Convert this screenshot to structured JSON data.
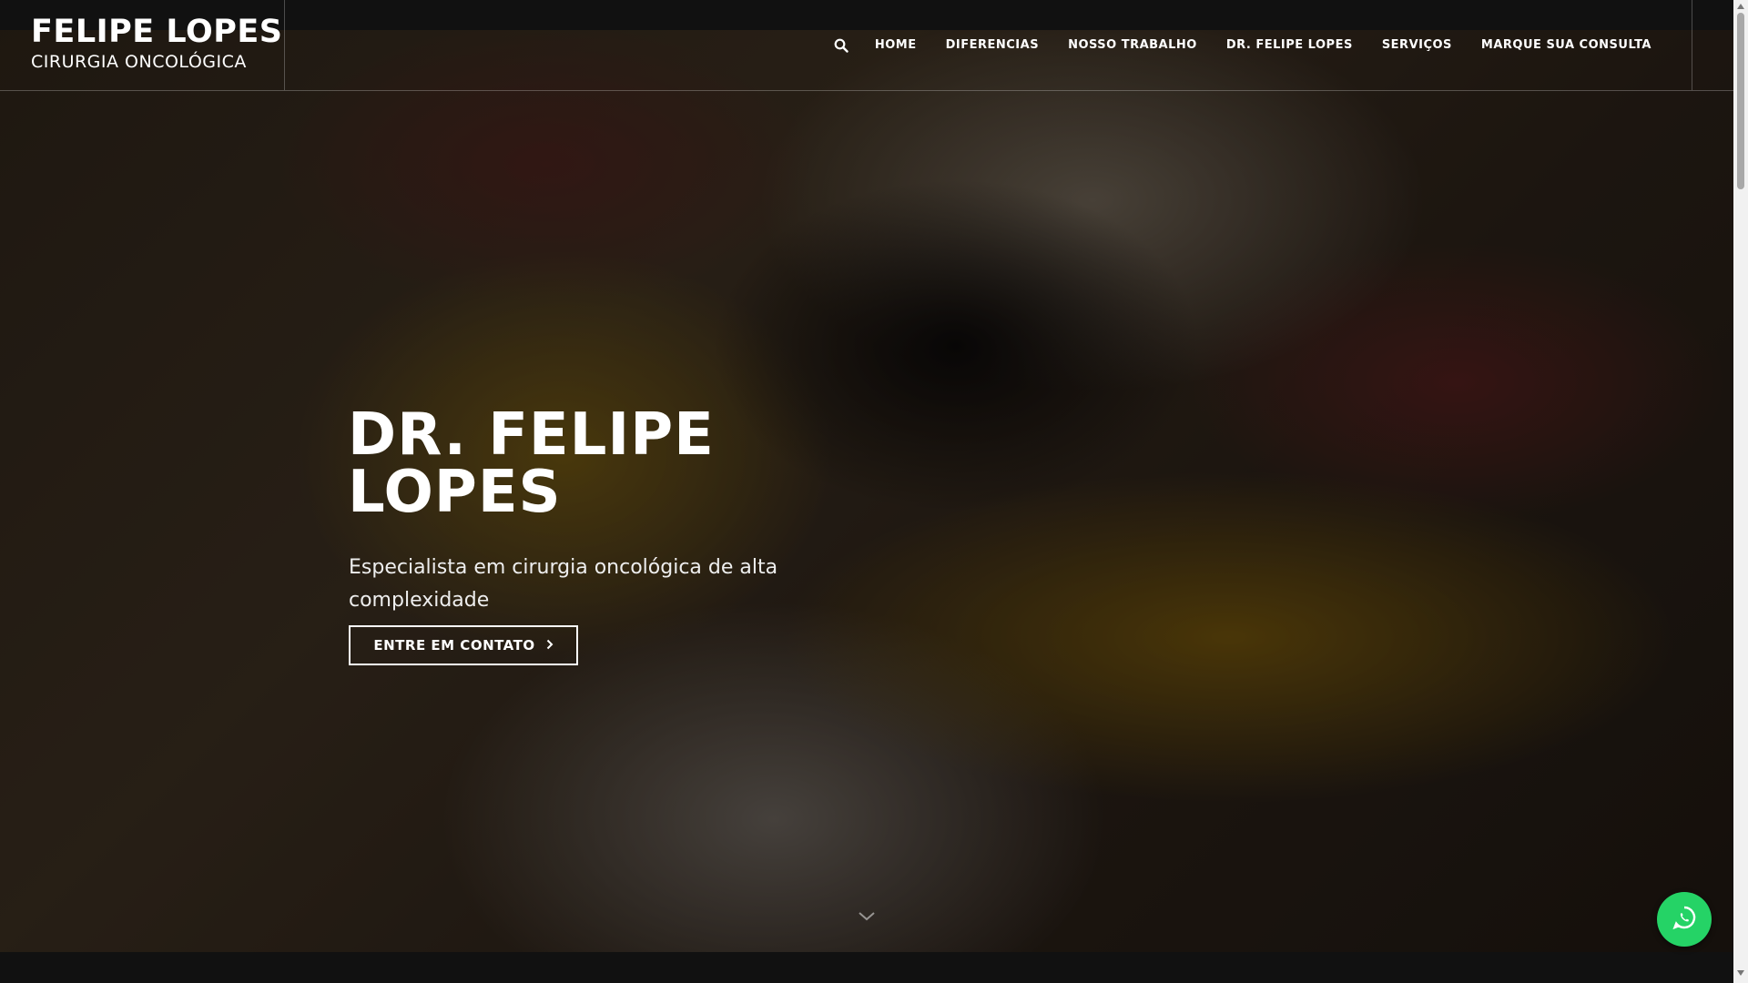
{
  "logo": {
    "title": "FELIPE LOPES",
    "subtitle": "CIRURGIA ONCOLÓGICA"
  },
  "nav": {
    "search_icon": "search-icon",
    "items": [
      {
        "label": "HOME"
      },
      {
        "label": "DIFERENCIAS"
      },
      {
        "label": "NOSSO TRABALHO"
      },
      {
        "label": "DR. FELIPE LOPES"
      },
      {
        "label": "SERVIÇOS"
      },
      {
        "label": "MARQUE SUA CONSULTA"
      }
    ]
  },
  "hero": {
    "title": "DR. FELIPE LOPES",
    "subtitle": "Especialista em cirurgia oncológica de alta complexidade",
    "cta_label": "ENTRE EM CONTATO",
    "cta_icon": "chevron-right-icon",
    "scroll_icon": "chevron-down-icon"
  },
  "floating": {
    "whatsapp_icon": "whatsapp-icon",
    "color": "#25d366"
  }
}
